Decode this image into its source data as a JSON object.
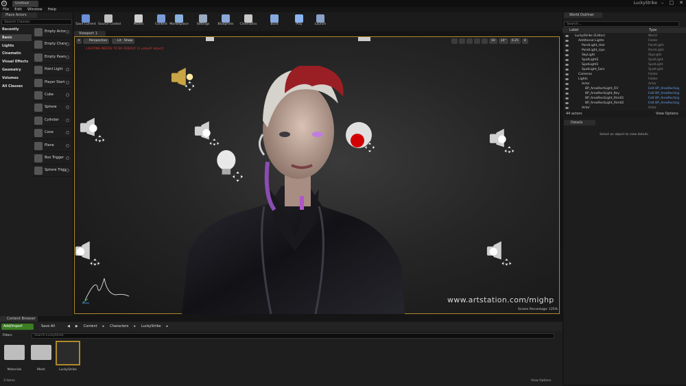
{
  "window": {
    "title": "LuckyStrike",
    "logo": "U",
    "tab": "Untitled"
  },
  "menu": [
    "File",
    "Edit",
    "Window",
    "Help"
  ],
  "place_actors": {
    "tab": "Place Actors",
    "search_placeholder": "Search Classes",
    "categories": [
      "Recently Placed",
      "Basic",
      "Lights",
      "Cinematic",
      "Visual Effects",
      "Geometry",
      "Volumes",
      "All Classes"
    ],
    "selected_category": "Basic",
    "items": [
      "Empty Actor",
      "Empty Chara",
      "Empty Pawn",
      "Point Light",
      "Player Start",
      "Cube",
      "Sphere",
      "Cylinder",
      "Cone",
      "Plane",
      "Box Trigger",
      "Sphere Trigg"
    ]
  },
  "toolbar": [
    {
      "label": "Save Current",
      "icon": "save-icon",
      "color": "#6b8fd8"
    },
    {
      "label": "Source Control",
      "icon": "source-control-icon",
      "color": "#c0c0c0"
    },
    {
      "label": "Modes",
      "icon": "modes-icon",
      "color": "#d0d0d0"
    },
    {
      "label": "Content",
      "icon": "content-icon",
      "color": "#7a9bd8"
    },
    {
      "label": "Marketplace",
      "icon": "marketplace-icon",
      "color": "#8ab0e0"
    },
    {
      "label": "Settings",
      "icon": "settings-icon",
      "color": "#9aaac0"
    },
    {
      "label": "Blueprints",
      "icon": "blueprints-icon",
      "color": "#8aa8d8"
    },
    {
      "label": "Cinematics",
      "icon": "cinematics-icon",
      "color": "#c8c8c8"
    },
    {
      "label": "Build",
      "icon": "build-icon",
      "color": "#88a8e0"
    },
    {
      "label": "Play",
      "icon": "play-icon",
      "color": "#8ab4f0"
    },
    {
      "label": "Launch",
      "icon": "launch-icon",
      "color": "#8aa0c8"
    }
  ],
  "viewport": {
    "tab": "Viewport 1",
    "buttons": [
      "Perspective",
      "Lit",
      "Show"
    ],
    "warning": "LIGHTING NEEDS TO BE REBUILT (1 unbuilt object)",
    "right_controls": [
      "10",
      "10°",
      "0.25",
      "4"
    ],
    "screen_percentage": "Screen Percentage: 125%",
    "watermark": "www.artstation.com/mighp"
  },
  "outliner": {
    "tab": "World Outliner",
    "search_placeholder": "Search...",
    "col_label": "Label",
    "col_type": "Type",
    "rows": [
      {
        "name": "LuckyStrike (Editor)",
        "type": "World",
        "indent": 0
      },
      {
        "name": "Additional Lights",
        "type": "Folder",
        "indent": 1
      },
      {
        "name": "PointLight_Hair",
        "type": "PointLight",
        "indent": 2
      },
      {
        "name": "PointLight_Lips",
        "type": "PointLight",
        "indent": 2
      },
      {
        "name": "SkyLight",
        "type": "SkyLight",
        "indent": 2
      },
      {
        "name": "SpotLight2",
        "type": "SpotLight",
        "indent": 2
      },
      {
        "name": "SpotLight1",
        "type": "SpotLight",
        "indent": 2
      },
      {
        "name": "SpotLight_Ears",
        "type": "SpotLight",
        "indent": 2
      },
      {
        "name": "Cameras",
        "type": "Folder",
        "indent": 1
      },
      {
        "name": "Lights",
        "type": "Folder",
        "indent": 1
      },
      {
        "name": "Actor",
        "type": "Actor",
        "indent": 2
      },
      {
        "name": "BP_AreaRectLight_Fill",
        "type": "Edit BP_AreaRectLig",
        "indent": 3
      },
      {
        "name": "BP_AreaRectLight_Key",
        "type": "Edit BP_AreaRectLig",
        "indent": 3
      },
      {
        "name": "BP_AreaRectLight_Rim01",
        "type": "Edit BP_AreaRectLig",
        "indent": 3
      },
      {
        "name": "BP_AreaRectLight_Rim02",
        "type": "Edit BP_AreaRectLig",
        "indent": 3
      },
      {
        "name": "Actor",
        "type": "Actor",
        "indent": 2
      }
    ],
    "actor_count": "44 actors",
    "view_options": "View Options"
  },
  "details": {
    "tab": "Details",
    "message": "Select an object to view details."
  },
  "content_browser": {
    "tab": "Content Browser",
    "add_import": "Add/Import",
    "save_all": "Save All",
    "path": [
      "Content",
      "Characters",
      "LuckyStrike"
    ],
    "filters": "Filters",
    "search_placeholder": "Search LuckyStrike",
    "assets": [
      {
        "name": "Materials",
        "kind": "folder"
      },
      {
        "name": "Mesh",
        "kind": "folder"
      },
      {
        "name": "LuckyStrike",
        "kind": "map"
      }
    ],
    "item_count": "3 items",
    "view_options": "View Options"
  },
  "colors": {
    "accent_selected": "#b08a2a",
    "add_button": "#3a7d22",
    "warning": "#e23232",
    "link": "#6aa0e8"
  }
}
